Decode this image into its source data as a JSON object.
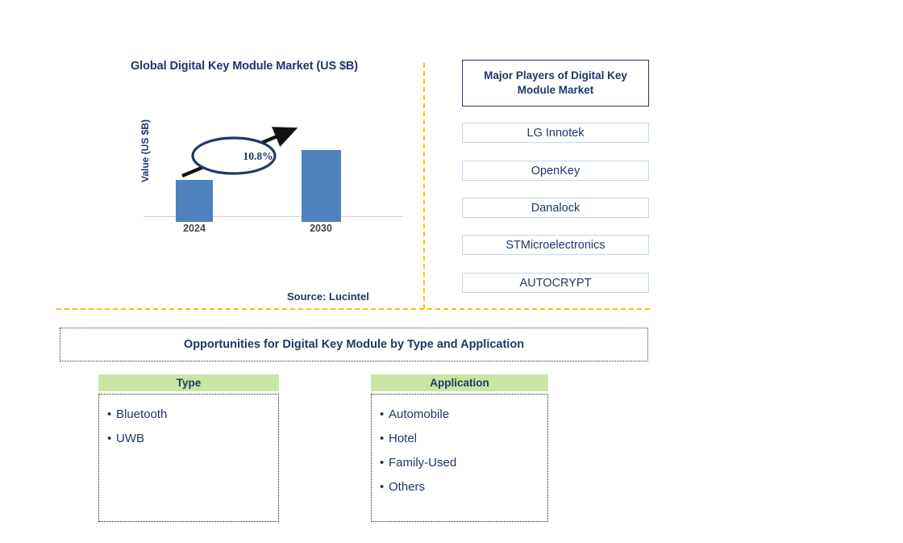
{
  "chart_panel": {
    "title": "Global Digital Key Module Market (US $B)",
    "y_axis_label": "Value (US $B)",
    "cagr_label": "10.8%",
    "source": "Source: Lucintel"
  },
  "chart_data": {
    "type": "bar",
    "title": "Global Digital Key Module Market (US $B)",
    "categories": [
      "2024",
      "2030"
    ],
    "values": [
      0.48,
      0.82
    ],
    "xlabel": "",
    "ylabel": "Value (US $B)",
    "ylim": [
      0,
      1.0
    ],
    "grid": false,
    "legend": "none",
    "bar_color": "#4F81BD",
    "annotations": [
      {
        "text": "10.8%",
        "type": "cagr-arrow",
        "from_category": "2024",
        "to_category": "2030"
      }
    ],
    "source": "Source: Lucintel"
  },
  "players_panel": {
    "header": "Major Players of Digital Key Module Market",
    "items": [
      {
        "label": "LG Innotek"
      },
      {
        "label": "OpenKey"
      },
      {
        "label": "Danalock"
      },
      {
        "label": "STMicroelectronics"
      },
      {
        "label": "AUTOCRYPT"
      }
    ]
  },
  "opportunities": {
    "banner": "Opportunities for Digital Key Module by Type and Application",
    "columns": [
      {
        "header": "Type",
        "items": [
          "Bluetooth",
          "UWB"
        ]
      },
      {
        "header": "Application",
        "items": [
          "Automobile",
          "Hotel",
          "Family-Used",
          "Others"
        ]
      }
    ]
  },
  "theme": {
    "navy": "#1F3864",
    "bar_blue": "#4F81BD",
    "amber": "#FFC000",
    "green": "#CBE6A4",
    "light_blue_border": "#BDD7EE",
    "tick_gray": "#4A453F"
  },
  "bullet_glyph": "•"
}
